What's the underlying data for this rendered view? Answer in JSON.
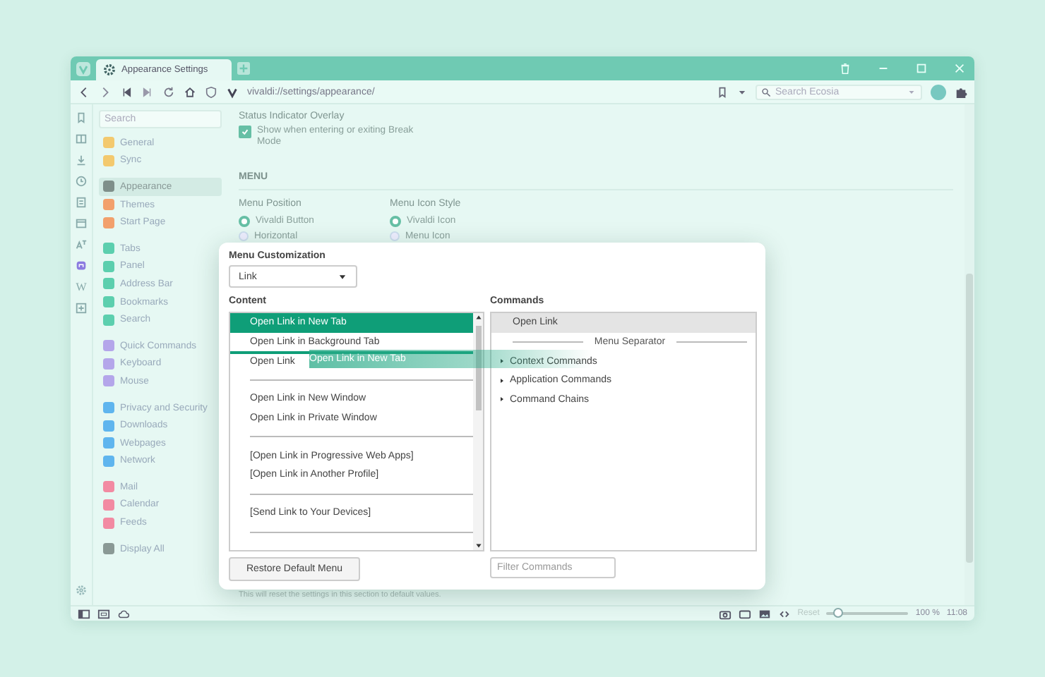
{
  "window": {
    "tab_title": "Appearance Settings",
    "url": "vivaldi://settings/appearance/",
    "search_placeholder": "Search Ecosia",
    "web_panel_label": "W"
  },
  "sidebar": {
    "search_placeholder": "Search",
    "groups": [
      [
        {
          "label": "General",
          "color": "#f3c96e",
          "selected": false
        },
        {
          "label": "Sync",
          "color": "#f3c96e",
          "selected": false
        }
      ],
      [
        {
          "label": "Appearance",
          "color": "#7f8f8a",
          "selected": true
        },
        {
          "label": "Themes",
          "color": "#f2a06c",
          "selected": false
        },
        {
          "label": "Start Page",
          "color": "#f2a06c",
          "selected": false
        }
      ],
      [
        {
          "label": "Tabs",
          "color": "#5ccfae",
          "selected": false
        },
        {
          "label": "Panel",
          "color": "#5ccfae",
          "selected": false
        },
        {
          "label": "Address Bar",
          "color": "#5ccfae",
          "selected": false
        },
        {
          "label": "Bookmarks",
          "color": "#5ccfae",
          "selected": false
        },
        {
          "label": "Search",
          "color": "#5ccfae",
          "selected": false
        }
      ],
      [
        {
          "label": "Quick Commands",
          "color": "#b4a6ea",
          "selected": false
        },
        {
          "label": "Keyboard",
          "color": "#b4a6ea",
          "selected": false
        },
        {
          "label": "Mouse",
          "color": "#b4a6ea",
          "selected": false
        }
      ],
      [
        {
          "label": "Privacy and Security",
          "color": "#5fb5ee",
          "selected": false
        },
        {
          "label": "Downloads",
          "color": "#5fb5ee",
          "selected": false
        },
        {
          "label": "Webpages",
          "color": "#5fb5ee",
          "selected": false
        },
        {
          "label": "Network",
          "color": "#5fb5ee",
          "selected": false
        }
      ],
      [
        {
          "label": "Mail",
          "color": "#f28aa2",
          "selected": false
        },
        {
          "label": "Calendar",
          "color": "#f28aa2",
          "selected": false
        },
        {
          "label": "Feeds",
          "color": "#f28aa2",
          "selected": false
        }
      ],
      [
        {
          "label": "Display All",
          "color": "#8a9995",
          "selected": false
        }
      ]
    ]
  },
  "settings": {
    "status_overlay": {
      "title": "Status Indicator Overlay",
      "checkbox": {
        "label": "Show when entering or exiting Break Mode",
        "checked": true
      }
    },
    "menu_heading": "MENU",
    "menu_position": {
      "title": "Menu Position",
      "options": [
        {
          "label": "Vivaldi Button",
          "selected": true
        },
        {
          "label": "Horizontal",
          "selected": false
        }
      ]
    },
    "menu_icon_style": {
      "title": "Menu Icon Style",
      "options": [
        {
          "label": "Vivaldi Icon",
          "selected": true
        },
        {
          "label": "Menu Icon",
          "selected": false
        }
      ]
    },
    "reset_note": "This will reset the settings in this section to default values."
  },
  "dialog": {
    "title": "Menu Customization",
    "dropdown": "Link",
    "content_heading": "Content",
    "commands_heading": "Commands",
    "content_items": [
      {
        "kind": "item",
        "label": "Open Link in New Tab",
        "selected": true,
        "drop_target": false
      },
      {
        "kind": "item",
        "label": "Open Link in Background Tab",
        "selected": false,
        "drop_target": false
      },
      {
        "kind": "item",
        "label": "Open Link",
        "selected": false,
        "drop_target": true
      },
      {
        "kind": "separator"
      },
      {
        "kind": "item",
        "label": "Open Link in New Window",
        "selected": false,
        "drop_target": false
      },
      {
        "kind": "item",
        "label": "Open Link in Private Window",
        "selected": false,
        "drop_target": false
      },
      {
        "kind": "separator"
      },
      {
        "kind": "item",
        "label": "[Open Link in Progressive Web Apps]",
        "selected": false,
        "drop_target": false
      },
      {
        "kind": "item",
        "label": "[Open Link in Another Profile]",
        "selected": false,
        "drop_target": false
      },
      {
        "kind": "separator"
      },
      {
        "kind": "item",
        "label": "[Send Link to Your Devices]",
        "selected": false,
        "drop_target": false
      },
      {
        "kind": "separator"
      }
    ],
    "drag_ghost": "Open Link in New Tab",
    "commands": [
      {
        "kind": "item",
        "label": "Open Link",
        "selected": true
      },
      {
        "kind": "separator",
        "label": "Menu Separator",
        "selected": false
      },
      {
        "kind": "group",
        "label": "Context Commands",
        "selected": false
      },
      {
        "kind": "group",
        "label": "Application Commands",
        "selected": false
      },
      {
        "kind": "group",
        "label": "Command Chains",
        "selected": false
      }
    ],
    "restore_button": "Restore Default Menu",
    "filter_placeholder": "Filter Commands"
  },
  "status_bar": {
    "reset": "Reset",
    "zoom": {
      "level": 0.15
    },
    "zoom_text": "100 %",
    "time": "11:08"
  }
}
